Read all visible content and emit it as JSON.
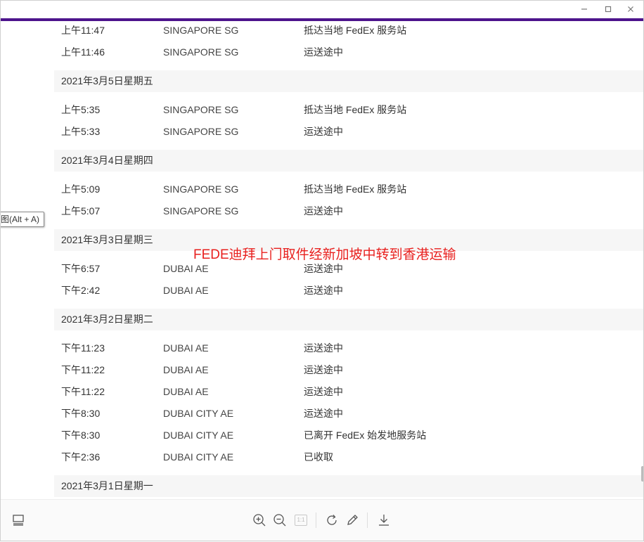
{
  "window": {
    "minimize_label": "–",
    "maximize_label": "☐",
    "close_label": "✕"
  },
  "groups": [
    {
      "date": "",
      "events": [
        {
          "time": "上午11:47",
          "location": "SINGAPORE SG",
          "status": "抵达当地 FedEx 服务站"
        },
        {
          "time": "上午11:46",
          "location": "SINGAPORE SG",
          "status": "运送途中"
        }
      ]
    },
    {
      "date": "2021年3月5日星期五",
      "events": [
        {
          "time": "上午5:35",
          "location": "SINGAPORE SG",
          "status": "抵达当地 FedEx 服务站"
        },
        {
          "time": "上午5:33",
          "location": "SINGAPORE SG",
          "status": "运送途中"
        }
      ]
    },
    {
      "date": "2021年3月4日星期四",
      "events": [
        {
          "time": "上午5:09",
          "location": "SINGAPORE SG",
          "status": "抵达当地 FedEx 服务站"
        },
        {
          "time": "上午5:07",
          "location": "SINGAPORE SG",
          "status": "运送途中"
        }
      ]
    },
    {
      "date": "2021年3月3日星期三",
      "events": [
        {
          "time": "下午6:57",
          "location": "DUBAI AE",
          "status": "运送途中"
        },
        {
          "time": "下午2:42",
          "location": "DUBAI AE",
          "status": "运送途中"
        }
      ]
    },
    {
      "date": "2021年3月2日星期二",
      "events": [
        {
          "time": "下午11:23",
          "location": "DUBAI AE",
          "status": "运送途中"
        },
        {
          "time": "下午11:22",
          "location": "DUBAI AE",
          "status": "运送途中"
        },
        {
          "time": "下午11:22",
          "location": "DUBAI AE",
          "status": "运送途中"
        },
        {
          "time": "下午8:30",
          "location": "DUBAI CITY AE",
          "status": "运送途中"
        },
        {
          "time": "下午8:30",
          "location": "DUBAI CITY AE",
          "status": "已离开 FedEx 始发地服务站"
        },
        {
          "time": "下午2:36",
          "location": "DUBAI CITY AE",
          "status": "已收取"
        }
      ]
    },
    {
      "date": "2021年3月1日星期一",
      "events": []
    }
  ],
  "overlay_title": "FEDE迪拜上门取件经新加坡中转到香港运输",
  "tooltip": "图(Alt + A)",
  "toolbar": {
    "page_indicator": "1:1"
  },
  "colors": {
    "accent": "#4d148c",
    "overlay_text": "#e8201e",
    "date_row_bg": "#f6f6f6"
  }
}
